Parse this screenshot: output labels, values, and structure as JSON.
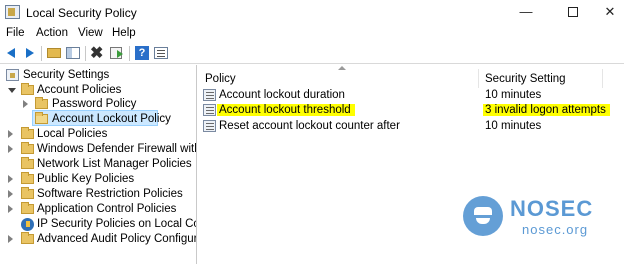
{
  "window": {
    "title": "Local Security Policy"
  },
  "menu": [
    "File",
    "Action",
    "View",
    "Help"
  ],
  "toolbar": {
    "buttons": [
      "back-arrow-icon",
      "forward-arrow-icon",
      "up-folder-icon",
      "show-hide-tree-icon",
      "delete-icon",
      "export-list-icon",
      "help-icon",
      "properties-icon"
    ]
  },
  "tree": {
    "root": "Security Settings",
    "account_policies": "Account Policies",
    "password_policy": "Password Policy",
    "account_lockout_policy": "Account Lockout Policy",
    "local_policies": "Local Policies",
    "firewall": "Windows Defender Firewall with Adva",
    "network_list": "Network List Manager Policies",
    "public_key": "Public Key Policies",
    "software_restriction": "Software Restriction Policies",
    "app_control": "Application Control Policies",
    "ip_security": "IP Security Policies on Local Compute",
    "audit": "Advanced Audit Policy Configuration"
  },
  "list": {
    "columns": {
      "policy": "Policy",
      "setting": "Security Setting"
    },
    "rows": [
      {
        "policy": "Account lockout duration",
        "setting": "10 minutes"
      },
      {
        "policy": "Account lockout threshold",
        "setting": "3 invalid logon attempts"
      },
      {
        "policy": "Reset account lockout counter after",
        "setting": "10 minutes"
      }
    ]
  },
  "watermark": {
    "brand": "NOSEC",
    "url": "nosec.org"
  },
  "colors": {
    "highlight": "#ffff00",
    "selection": "#cce8ff",
    "accent": "#4a8fd0"
  }
}
